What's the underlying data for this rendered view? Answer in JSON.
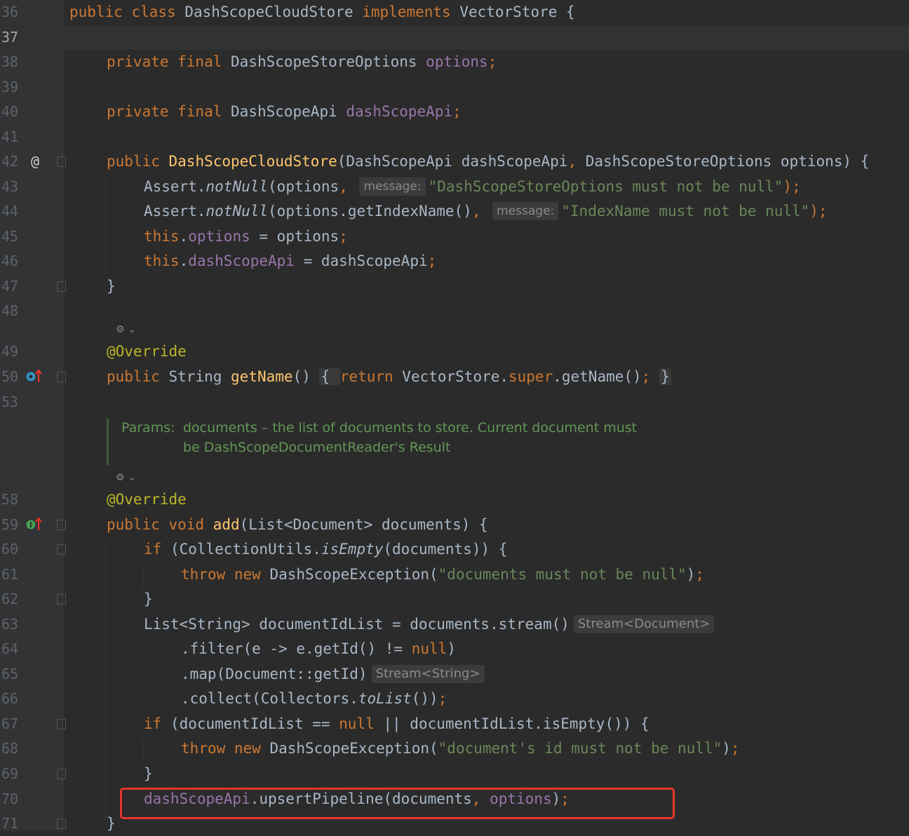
{
  "gutter_icons": {
    "l42": "@",
    "l50": "override-up-arrow-icon",
    "l59": "implements-up-arrow-icon"
  },
  "lines": {
    "l36": {
      "n": "36",
      "t1": "public class ",
      "t2": "DashScopeCloudStore ",
      "t3": "implements ",
      "t4": "VectorStore {"
    },
    "l37": {
      "n": "37"
    },
    "l38": {
      "n": "38",
      "t1": "private final ",
      "t2": "DashScopeStoreOptions ",
      "t3": "options",
      "t4": ";"
    },
    "l39": {
      "n": "39"
    },
    "l40": {
      "n": "40",
      "t1": "private final ",
      "t2": "DashScopeApi ",
      "t3": "dashScopeApi",
      "t4": ";"
    },
    "l41": {
      "n": "41"
    },
    "l42": {
      "n": "42",
      "t1": "public ",
      "t2": "DashScopeCloudStore",
      "t3": "(DashScopeApi dashScopeApi",
      "t4": ", ",
      "t5": "DashScopeStoreOptions options) {"
    },
    "l43": {
      "n": "43",
      "t1": "Assert.",
      "t2": "notNull",
      "t3": "(options",
      "t4": ", ",
      "h": "message:",
      "t5": "\"DashScopeStoreOptions must not be null\"",
      "t6": ");"
    },
    "l44": {
      "n": "44",
      "t1": "Assert.",
      "t2": "notNull",
      "t3": "(options.getIndexName()",
      "t4": ", ",
      "h": "message:",
      "t5": "\"IndexName must not be null\"",
      "t6": ");"
    },
    "l45": {
      "n": "45",
      "t1": "this",
      "t2": ".",
      "t3": "options",
      "t4": " = options",
      "t5": ";"
    },
    "l46": {
      "n": "46",
      "t1": "this",
      "t2": ".",
      "t3": "dashScopeApi",
      "t4": " = dashScopeApi",
      "t5": ";"
    },
    "l47": {
      "n": "47",
      "t1": "}"
    },
    "l48": {
      "n": "48"
    },
    "l49": {
      "n": "49",
      "t1": "@Override"
    },
    "l50": {
      "n": "50",
      "t1": "public ",
      "t2": "String ",
      "t3": "getName",
      "t4": "() ",
      "t5": "{ ",
      "t6": "return ",
      "t7": "VectorStore.",
      "t8": "super",
      "t9": ".getName()",
      "t10": "; ",
      "t11": "}"
    },
    "l53": {
      "n": "53"
    },
    "l58": {
      "n": "58",
      "t1": "@Override"
    },
    "l59": {
      "n": "59",
      "t1": "public void ",
      "t2": "add",
      "t3": "(List<Document> documents) {"
    },
    "l60": {
      "n": "60",
      "t1": "if ",
      "t2": "(CollectionUtils.",
      "t3": "isEmpty",
      "t4": "(documents)) {"
    },
    "l61": {
      "n": "61",
      "t1": "throw new ",
      "t2": "DashScopeException(",
      "t3": "\"documents must not be null\"",
      "t4": ")",
      "t5": ";"
    },
    "l62": {
      "n": "62",
      "t1": "}"
    },
    "l63": {
      "n": "63",
      "t1": "List<String> documentIdList = documents.stream()",
      "h": "Stream<Document>"
    },
    "l64": {
      "n": "64",
      "t1": ".filter(e -> e.getId() != ",
      "t2": "null",
      "t3": ")"
    },
    "l65": {
      "n": "65",
      "t1": ".map(Document::getId)",
      "h": "Stream<String>"
    },
    "l66": {
      "n": "66",
      "t1": ".collect(Collectors.",
      "t2": "toList",
      "t3": "())",
      "t4": ";"
    },
    "l67": {
      "n": "67",
      "t1": "if ",
      "t2": "(documentIdList == ",
      "t3": "null ",
      "t4": "|| documentIdList.isEmpty()) {"
    },
    "l68": {
      "n": "68",
      "t1": "throw new ",
      "t2": "DashScopeException(",
      "t3": "\"document's id must not be null\"",
      "t4": ")",
      "t5": ";"
    },
    "l69": {
      "n": "69",
      "t1": "}"
    },
    "l70": {
      "n": "70",
      "t1": "dashScopeApi",
      "t2": ".upsertPipeline(documents",
      "t3": ", ",
      "t4": "options",
      "t5": ")",
      "t6": ";"
    },
    "l71": {
      "n": "71",
      "t1": "}"
    }
  },
  "javadoc": {
    "label": "Params:",
    "line1": "documents – the list of documents to store. Current document must",
    "line2": "be DashScopeDocumentReader's Result"
  },
  "colors": {
    "background": "#2b2b2b",
    "keyword": "#cc7832",
    "method": "#ffc66d",
    "field": "#9876aa",
    "string": "#6a8759",
    "annotation": "#bbb529",
    "highlight_box": "#e8352b"
  }
}
